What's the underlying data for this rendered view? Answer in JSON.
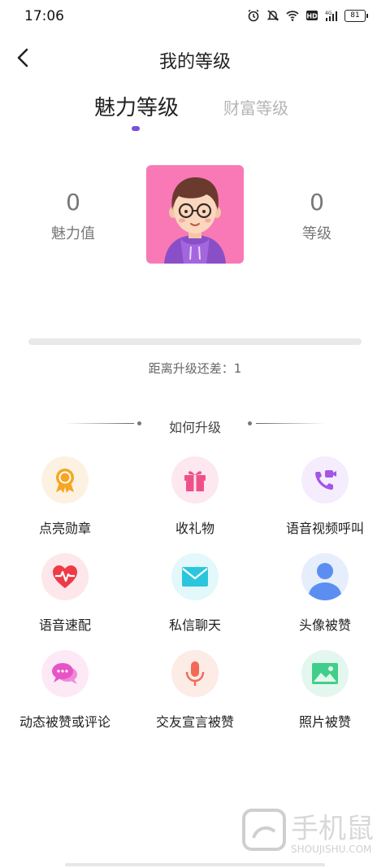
{
  "status_bar": {
    "time": "17:06",
    "battery": "81",
    "icons": [
      "alarm-icon",
      "mute-icon",
      "wifi-icon",
      "hd-icon",
      "signal-4g-icon",
      "battery-icon"
    ]
  },
  "header": {
    "title": "我的等级",
    "back_icon": "chevron-left-icon"
  },
  "tabs": [
    {
      "label": "魅力等级",
      "active": true
    },
    {
      "label": "财富等级",
      "active": false
    }
  ],
  "stats": {
    "charm_value": "0",
    "charm_label": "魅力值",
    "level_value": "0",
    "level_label": "等级"
  },
  "progress": {
    "fraction": 0,
    "remaining_text": "距离升级还差：1"
  },
  "section": {
    "title": "如何升级"
  },
  "items": [
    {
      "label": "点亮勋章",
      "icon": "medal-icon",
      "bg": "#fdf2e2",
      "color": "#f5a623"
    },
    {
      "label": "收礼物",
      "icon": "gift-icon",
      "bg": "#fde8ef",
      "color": "#f0508a"
    },
    {
      "label": "语音视频呼叫",
      "icon": "phone-video-icon",
      "bg": "#f5ecfd",
      "color": "#a356e6"
    },
    {
      "label": "语音速配",
      "icon": "heartbeat-icon",
      "bg": "#fde7ea",
      "color": "#ee3b46"
    },
    {
      "label": "私信聊天",
      "icon": "mail-icon",
      "bg": "#e2f8fb",
      "color": "#2cc6dc"
    },
    {
      "label": "头像被赞",
      "icon": "user-icon",
      "bg": "#e6eefb",
      "color": "#5b8ef0"
    },
    {
      "label": "动态被赞或评论",
      "icon": "chat-bubble-icon",
      "bg": "#fde9f6",
      "color": "#e655c5"
    },
    {
      "label": "交友宣言被赞",
      "icon": "microphone-icon",
      "bg": "#fdebe6",
      "color": "#f06a56"
    },
    {
      "label": "照片被赞",
      "icon": "image-icon",
      "bg": "#e4f7ee",
      "color": "#3fcf8a"
    }
  ],
  "colors": {
    "accent": "#7b4fe0",
    "avatar_bg": "#f879b5"
  }
}
